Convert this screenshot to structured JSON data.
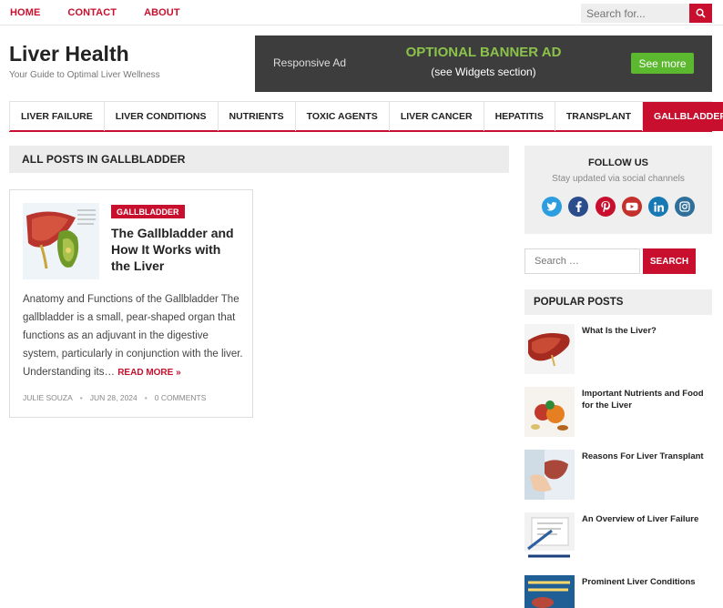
{
  "topnav": {
    "items": [
      "HOME",
      "CONTACT",
      "ABOUT"
    ],
    "search_placeholder": "Search for..."
  },
  "header": {
    "title": "Liver Health",
    "tagline": "Your Guide to Optimal Liver Wellness"
  },
  "banner": {
    "responsive": "Responsive Ad",
    "headline": "OPTIONAL BANNER AD",
    "subline": "(see Widgets section)",
    "button": "See more"
  },
  "mainnav": {
    "items": [
      "LIVER FAILURE",
      "LIVER CONDITIONS",
      "NUTRIENTS",
      "TOXIC AGENTS",
      "LIVER CANCER",
      "HEPATITIS",
      "TRANSPLANT",
      "GALLBLADDER"
    ]
  },
  "archive": {
    "title": "ALL POSTS IN GALLBLADDER"
  },
  "post": {
    "category": "GALLBLADDER",
    "title": "The Gallbladder and How It Works with the Liver",
    "excerpt": "Anatomy and Functions of the Gallbladder The gallbladder is a small, pear-shaped organ that functions as an adjuvant in the digestive system, particularly in conjunction with the liver. Understanding its…",
    "read_more": "READ MORE »",
    "author": "JULIE SOUZA",
    "date": "JUN 28, 2024",
    "comments": "0 COMMENTS"
  },
  "sidebar": {
    "follow_title": "FOLLOW US",
    "follow_sub": "Stay updated via social channels",
    "socials": [
      {
        "name": "twitter",
        "color": "#2c9ee0"
      },
      {
        "name": "facebook",
        "color": "#2b4c8c"
      },
      {
        "name": "pinterest",
        "color": "#c8102e"
      },
      {
        "name": "youtube",
        "color": "#c4302b"
      },
      {
        "name": "linkedin",
        "color": "#1779b4"
      },
      {
        "name": "instagram",
        "color": "#2f6f99"
      }
    ],
    "search_placeholder": "Search …",
    "search_button": "SEARCH",
    "popular_title": "POPULAR POSTS",
    "popular": [
      "What Is the Liver?",
      "Important Nutrients and Food for the Liver",
      "Reasons For Liver Transplant",
      "An Overview of Liver Failure",
      "Prominent Liver Conditions"
    ]
  },
  "colors": {
    "accent": "#c8102e",
    "banner_bg": "#3d3d3d",
    "banner_green": "#5cb82f"
  }
}
